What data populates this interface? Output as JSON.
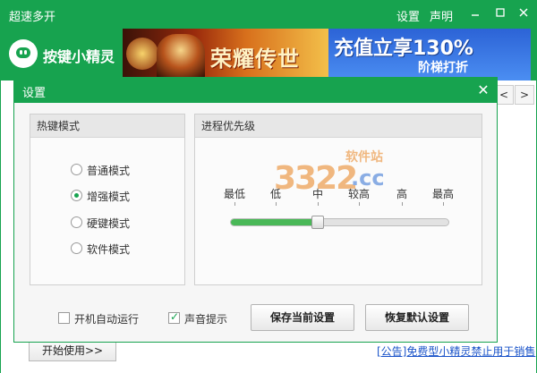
{
  "app": {
    "window_title": "超速多开",
    "header_links": [
      "设置",
      "声明"
    ],
    "brand": "按键小精灵",
    "colors": {
      "accent": "#17a34f",
      "link": "#1a53c9"
    }
  },
  "banners": {
    "left": {
      "headline": "荣耀传世"
    },
    "right": {
      "headline": "充值立享130%",
      "subline": "阶梯打折"
    }
  },
  "main": {
    "tab_arrows": [
      "<",
      ">"
    ],
    "start_button": "开始使用>>",
    "notice": "[公告]免费型小精灵禁止用于销售"
  },
  "dialog": {
    "title": "设置",
    "close": "✕",
    "hotkey_panel": {
      "header": "热键模式",
      "options": [
        "普通模式",
        "增强模式",
        "硬键模式",
        "软件模式"
      ],
      "selected_index": 1
    },
    "priority_panel": {
      "header": "进程优先级",
      "levels": [
        "最低",
        "低",
        "中",
        "较高",
        "高",
        "最高"
      ],
      "selected_level": "中"
    },
    "watermark": {
      "digits": "3322",
      "site": "软件站",
      "tld": ".cc"
    },
    "checkboxes": [
      {
        "label": "开机自动运行",
        "checked": false
      },
      {
        "label": "声音提示",
        "checked": true
      }
    ],
    "buttons": {
      "save": "保存当前设置",
      "restore": "恢复默认设置"
    }
  }
}
